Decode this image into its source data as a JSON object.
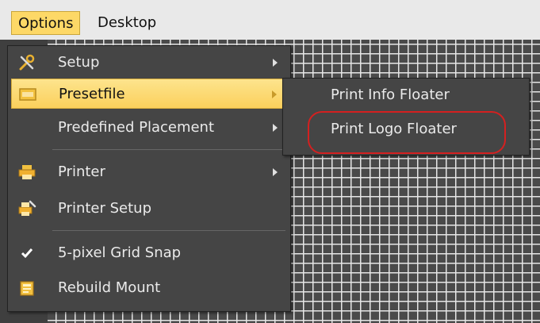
{
  "menubar": {
    "items": [
      {
        "label": "Options",
        "active": true
      },
      {
        "label": "Desktop",
        "active": false
      }
    ]
  },
  "options_menu": {
    "items": [
      {
        "label": "Setup",
        "icon": "tools-icon",
        "has_submenu": true
      },
      {
        "label": "Presetfile",
        "icon": "presetfile-icon",
        "has_submenu": true,
        "highlighted": true
      },
      {
        "label": "Predefined Placement",
        "icon": "",
        "has_submenu": true
      },
      {
        "label": "Printer",
        "icon": "printer-icon",
        "has_submenu": true
      },
      {
        "label": "Printer Setup",
        "icon": "printer-setup-icon",
        "has_submenu": false
      },
      {
        "label": "5-pixel Grid Snap",
        "icon": "checkmark-icon",
        "has_submenu": false,
        "checked": true
      },
      {
        "label": "Rebuild Mount",
        "icon": "rebuild-mount-icon",
        "has_submenu": false
      }
    ]
  },
  "presetfile_submenu": {
    "items": [
      {
        "label": "Print Info Floater"
      },
      {
        "label": "Print Logo Floater"
      }
    ]
  },
  "colors": {
    "highlight": "#fbd05c",
    "callout": "#d42020",
    "menu_background": "#454545"
  }
}
